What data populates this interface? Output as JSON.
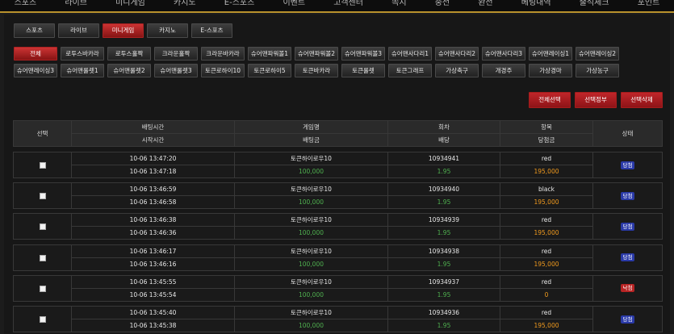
{
  "top_nav": [
    "스포츠",
    "라이브",
    "미니게임",
    "카지노",
    "E-스포츠",
    "이벤트",
    "고객센터",
    "쪽지",
    "충전",
    "환전",
    "베팅내역",
    "출석체크",
    "포인트"
  ],
  "category_tabs": [
    {
      "label": "스포츠",
      "active": false
    },
    {
      "label": "라이브",
      "active": false
    },
    {
      "label": "미니게임",
      "active": true
    },
    {
      "label": "카지노",
      "active": false
    },
    {
      "label": "E-스포츠",
      "active": false
    }
  ],
  "game_tabs": [
    {
      "label": "전체",
      "active": true
    },
    {
      "label": "로투스바카라",
      "active": false
    },
    {
      "label": "로투스홀짝",
      "active": false
    },
    {
      "label": "크라운홀짝",
      "active": false
    },
    {
      "label": "크라운바카라",
      "active": false
    },
    {
      "label": "슈어맨파워볼1",
      "active": false
    },
    {
      "label": "슈어맨파워볼2",
      "active": false
    },
    {
      "label": "슈어맨파워볼3",
      "active": false
    },
    {
      "label": "슈어맨사다리1",
      "active": false
    },
    {
      "label": "슈어맨사다리2",
      "active": false
    },
    {
      "label": "슈어맨사다리3",
      "active": false
    },
    {
      "label": "슈어맨레이싱1",
      "active": false
    },
    {
      "label": "슈어맨레이싱2",
      "active": false
    },
    {
      "label": "슈어맨레이싱3",
      "active": false
    },
    {
      "label": "슈어맨룰렛1",
      "active": false
    },
    {
      "label": "슈어맨룰렛2",
      "active": false
    },
    {
      "label": "슈어맨룰렛3",
      "active": false
    },
    {
      "label": "토큰로하이10",
      "active": false
    },
    {
      "label": "토큰로하이5",
      "active": false
    },
    {
      "label": "토큰바카라",
      "active": false
    },
    {
      "label": "토큰룰렛",
      "active": false
    },
    {
      "label": "토큰그래프",
      "active": false
    },
    {
      "label": "가상축구",
      "active": false
    },
    {
      "label": "개경주",
      "active": false
    },
    {
      "label": "가상경마",
      "active": false
    },
    {
      "label": "가상농구",
      "active": false
    }
  ],
  "actions": {
    "select_all": "전체선택",
    "select_cancel": "선택정부",
    "delete_selected": "선택삭제"
  },
  "table_header": {
    "select": "선택",
    "bet_time": "배팅시간",
    "start_time": "시작시간",
    "game_name": "게임명",
    "bet_amount": "배팅금",
    "round": "회차",
    "odds": "배당",
    "item": "항목",
    "win_amount": "당첨금",
    "status": "상태"
  },
  "bets": [
    {
      "bet_time": "10-06 13:47:20",
      "start_time": "10-06 13:47:18",
      "game": "토큰하이로우10",
      "amount": "100,000",
      "round": "10934941",
      "odds": "1.95",
      "pick": "red",
      "payout": "195,000",
      "status": "당첨",
      "status_type": "win"
    },
    {
      "bet_time": "10-06 13:46:59",
      "start_time": "10-06 13:46:58",
      "game": "토큰하이로우10",
      "amount": "100,000",
      "round": "10934940",
      "odds": "1.95",
      "pick": "black",
      "payout": "195,000",
      "status": "당첨",
      "status_type": "win"
    },
    {
      "bet_time": "10-06 13:46:38",
      "start_time": "10-06 13:46:36",
      "game": "토큰하이로우10",
      "amount": "100,000",
      "round": "10934939",
      "odds": "1.95",
      "pick": "red",
      "payout": "195,000",
      "status": "당첨",
      "status_type": "win"
    },
    {
      "bet_time": "10-06 13:46:17",
      "start_time": "10-06 13:46:16",
      "game": "토큰하이로우10",
      "amount": "100,000",
      "round": "10934938",
      "odds": "1.95",
      "pick": "red",
      "payout": "195,000",
      "status": "당첨",
      "status_type": "win"
    },
    {
      "bet_time": "10-06 13:45:55",
      "start_time": "10-06 13:45:54",
      "game": "토큰하이로우10",
      "amount": "100,000",
      "round": "10934937",
      "odds": "1.95",
      "pick": "red",
      "payout": "0",
      "status": "낙첨",
      "status_type": "lose"
    },
    {
      "bet_time": "10-06 13:45:40",
      "start_time": "10-06 13:45:38",
      "game": "토큰하이로우10",
      "amount": "100,000",
      "round": "10934936",
      "odds": "1.95",
      "pick": "red",
      "payout": "195,000",
      "status": "당첨",
      "status_type": "win"
    }
  ]
}
